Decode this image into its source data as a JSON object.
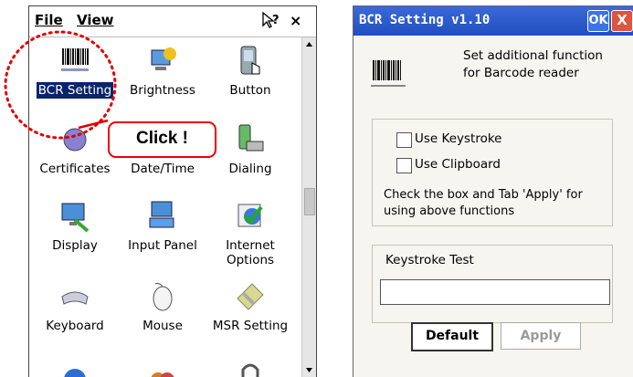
{
  "left_panel": {
    "menu": {
      "file": "File",
      "view": "View"
    },
    "help_label": "?",
    "close_label": "×",
    "items": [
      {
        "label": "BCR Setting",
        "icon": "barcode-icon"
      },
      {
        "label": "Brightness",
        "icon": "brightness-icon"
      },
      {
        "label": "Button",
        "icon": "button-icon"
      },
      {
        "label": "Certificates",
        "icon": "certificates-icon"
      },
      {
        "label": "Date/Time",
        "icon": "date-time-icon"
      },
      {
        "label": "Dialing",
        "icon": "dialing-icon"
      },
      {
        "label": "Display",
        "icon": "display-icon"
      },
      {
        "label": "Input Panel",
        "icon": "input-panel-icon"
      },
      {
        "label": "Internet Options",
        "icon": "internet-options-icon"
      },
      {
        "label": "Keyboard",
        "icon": "keyboard-icon"
      },
      {
        "label": "Mouse",
        "icon": "mouse-icon"
      },
      {
        "label": "MSR Setting",
        "icon": "msr-setting-icon"
      }
    ],
    "callout": "Click !",
    "highlight_color": "#e00000"
  },
  "dialog": {
    "title": "BCR Setting v1.10",
    "ok_label": "OK",
    "close_label": "X",
    "description": "Set additional function for Barcode reader",
    "checkboxes": [
      {
        "label": "Use Keystroke",
        "checked": false
      },
      {
        "label": "Use Clipboard",
        "checked": false
      }
    ],
    "note": "Check the box and Tab 'Apply' for using above functions",
    "keystroke_test_label": "Keystroke Test",
    "keystroke_value": "",
    "default_label": "Default",
    "apply_label": "Apply",
    "title_color": "#2a55c8"
  }
}
